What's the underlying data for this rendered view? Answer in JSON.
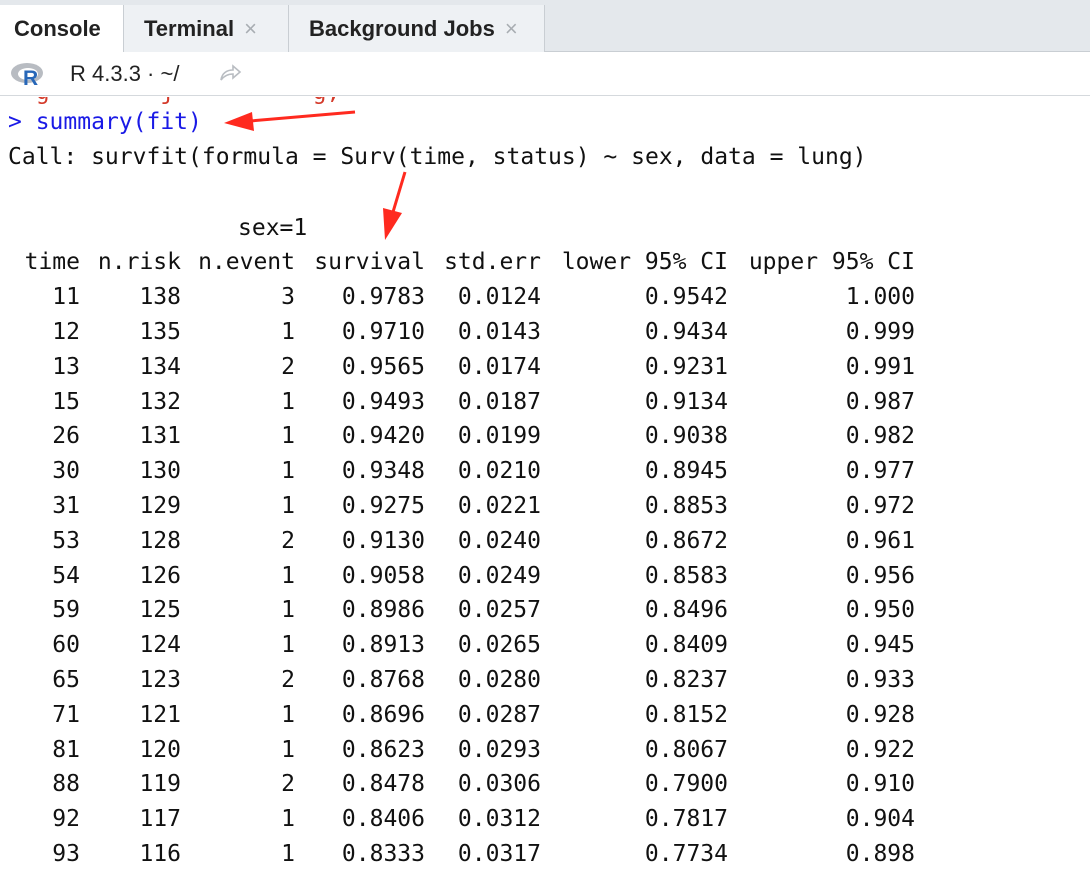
{
  "tabs": [
    {
      "label": "Console",
      "active": true,
      "closable": false
    },
    {
      "label": "Terminal",
      "active": false,
      "closable": true
    },
    {
      "label": "Background Jobs",
      "active": false,
      "closable": true
    }
  ],
  "toolbar": {
    "r_logo_letter": "R",
    "version_path": "R 4.3.3 · ~/",
    "icons": [
      "r-logo-icon",
      "share-icon"
    ]
  },
  "console": {
    "partial_prev_line": "  g        j          g,",
    "prompt": "> ",
    "command": "summary(fit)",
    "call_line": "Call: survfit(formula = Surv(time, status) ~ sex, data = lung)",
    "group_label": "sex=1",
    "headers": [
      "time",
      "n.risk",
      "n.event",
      "survival",
      "std.err",
      "lower 95% CI",
      "upper 95% CI"
    ],
    "rows": [
      [
        "11",
        "138",
        "3",
        "0.9783",
        "0.0124",
        "0.9542",
        "1.000"
      ],
      [
        "12",
        "135",
        "1",
        "0.9710",
        "0.0143",
        "0.9434",
        "0.999"
      ],
      [
        "13",
        "134",
        "2",
        "0.9565",
        "0.0174",
        "0.9231",
        "0.991"
      ],
      [
        "15",
        "132",
        "1",
        "0.9493",
        "0.0187",
        "0.9134",
        "0.987"
      ],
      [
        "26",
        "131",
        "1",
        "0.9420",
        "0.0199",
        "0.9038",
        "0.982"
      ],
      [
        "30",
        "130",
        "1",
        "0.9348",
        "0.0210",
        "0.8945",
        "0.977"
      ],
      [
        "31",
        "129",
        "1",
        "0.9275",
        "0.0221",
        "0.8853",
        "0.972"
      ],
      [
        "53",
        "128",
        "2",
        "0.9130",
        "0.0240",
        "0.8672",
        "0.961"
      ],
      [
        "54",
        "126",
        "1",
        "0.9058",
        "0.0249",
        "0.8583",
        "0.956"
      ],
      [
        "59",
        "125",
        "1",
        "0.8986",
        "0.0257",
        "0.8496",
        "0.950"
      ],
      [
        "60",
        "124",
        "1",
        "0.8913",
        "0.0265",
        "0.8409",
        "0.945"
      ],
      [
        "65",
        "123",
        "2",
        "0.8768",
        "0.0280",
        "0.8237",
        "0.933"
      ],
      [
        "71",
        "121",
        "1",
        "0.8696",
        "0.0287",
        "0.8152",
        "0.928"
      ],
      [
        "81",
        "120",
        "1",
        "0.8623",
        "0.0293",
        "0.8067",
        "0.922"
      ],
      [
        "88",
        "119",
        "2",
        "0.8478",
        "0.0306",
        "0.7900",
        "0.910"
      ],
      [
        "92",
        "117",
        "1",
        "0.8406",
        "0.0312",
        "0.7817",
        "0.904"
      ],
      [
        "93",
        "116",
        "1",
        "0.8333",
        "0.0317",
        "0.7734",
        "0.898"
      ]
    ]
  },
  "colors": {
    "prompt": "#1a1ae6",
    "annotation_arrow": "#ff2a1f",
    "tabbar_bg": "#e4e8ec",
    "text": "#111111"
  }
}
